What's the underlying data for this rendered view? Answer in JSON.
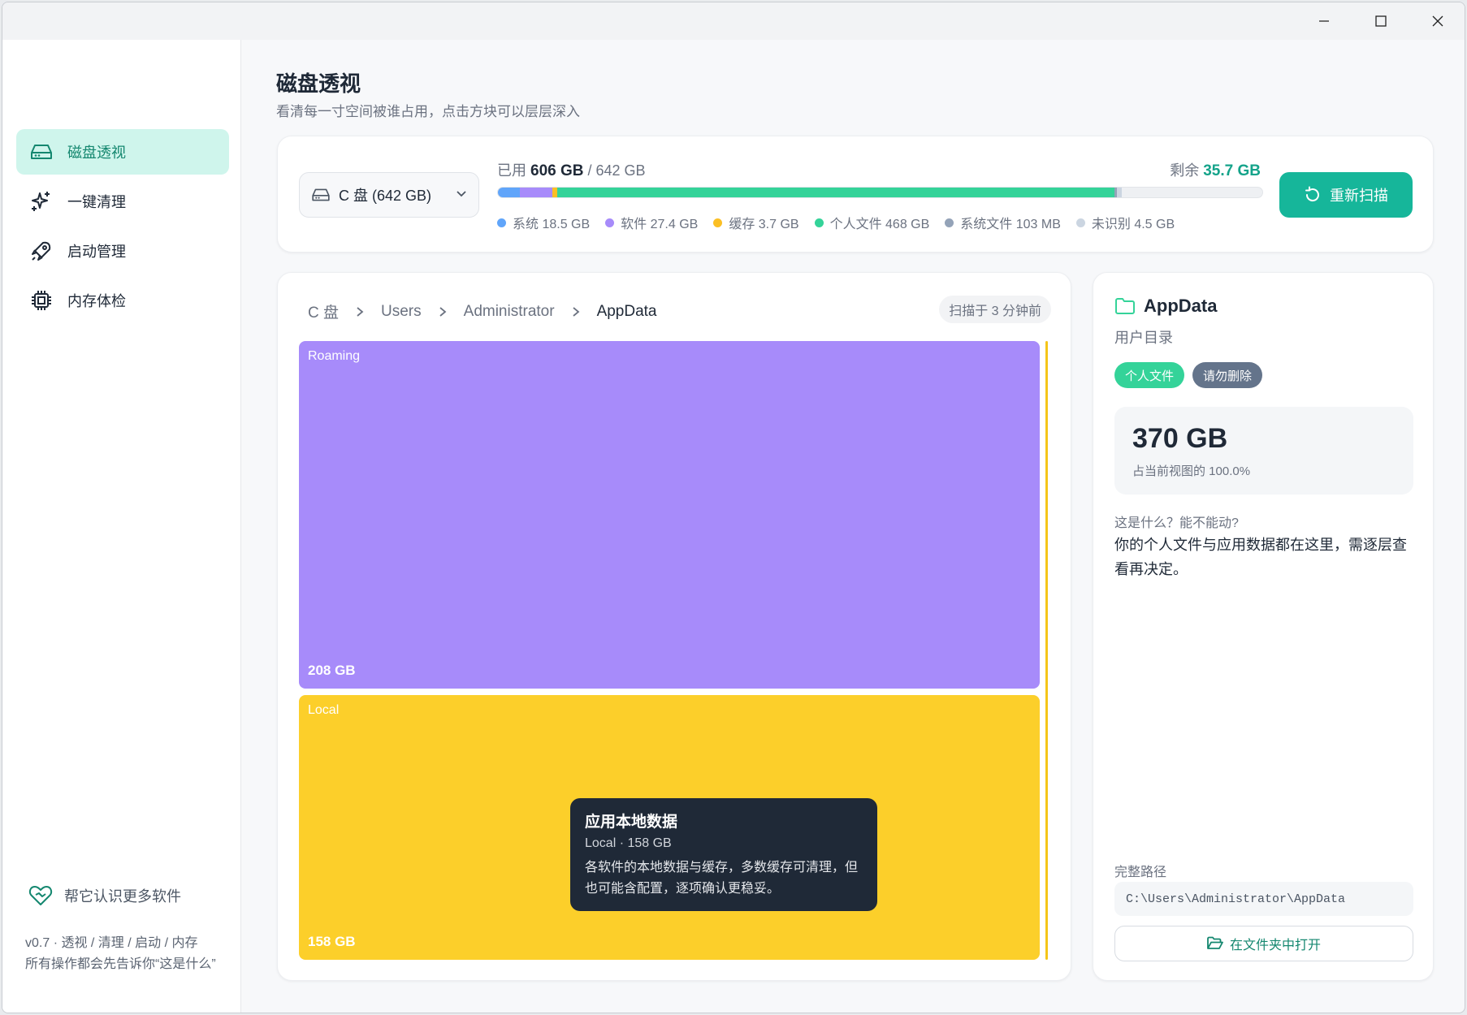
{
  "sidebar": {
    "items": [
      {
        "label": "磁盘透视",
        "icon": "hard-drive-icon",
        "active": true
      },
      {
        "label": "一键清理",
        "icon": "sparkles-icon"
      },
      {
        "label": "启动管理",
        "icon": "rocket-icon"
      },
      {
        "label": "内存体检",
        "icon": "chip-icon"
      }
    ],
    "help": "帮它认识更多软件",
    "footer_line1": "v0.7 · 透视 / 清理 / 启动 / 内存",
    "footer_line2": "所有操作都会先告诉你“这是什么”"
  },
  "header": {
    "title": "磁盘透视",
    "subtitle": "看清每一寸空间被谁占用，点击方块可以层层深入"
  },
  "disk": {
    "drive_select": "C 盘 (642 GB)",
    "used_prefix": "已用",
    "used": "606 GB",
    "total": "642 GB",
    "remain_label": "剩余",
    "remain": "35.7 GB",
    "rescan": "重新扫描",
    "segments": [
      {
        "label": "系统 18.5 GB",
        "gb": 18.5,
        "color": "#60a5fa"
      },
      {
        "label": "软件 27.4 GB",
        "gb": 27.4,
        "color": "#a78bfa"
      },
      {
        "label": "缓存 3.7 GB",
        "gb": 3.7,
        "color": "#fbbf24"
      },
      {
        "label": "个人文件 468 GB",
        "gb": 468,
        "color": "#34d399"
      },
      {
        "label": "系统文件 103 MB",
        "gb": 0.1,
        "color": "#94a3b8"
      },
      {
        "label": "未识别 4.5 GB",
        "gb": 4.5,
        "color": "#cbd5e1"
      }
    ]
  },
  "map": {
    "breadcrumb": [
      "C 盘",
      "Users",
      "Administrator",
      "AppData"
    ],
    "scan_time": "扫描于 3 分钟前",
    "tiles": [
      {
        "name": "Roaming",
        "size": "208 GB",
        "color": "#a78bfa"
      },
      {
        "name": "Local",
        "size": "158 GB",
        "color": "#fccf2a"
      }
    ],
    "tooltip": {
      "title": "应用本地数据",
      "meta": "Local · 158 GB",
      "desc": "各软件的本地数据与缓存，多数缓存可清理，但也可能含配置，逐项确认更稳妥。"
    }
  },
  "detail": {
    "name": "AppData",
    "category": "用户目录",
    "tags": [
      {
        "label": "个人文件",
        "color": "#34d399"
      },
      {
        "label": "请勿删除",
        "color": "#64748b"
      }
    ],
    "size": "370 GB",
    "share": "占当前视图的 100.0%",
    "question": "这是什么？能不能动?",
    "answer": "你的个人文件与应用数据都在这里，需逐层查看再决定。",
    "path_label": "完整路径",
    "path": "C:\\Users\\Administrator\\AppData",
    "open_button": "在文件夹中打开"
  }
}
